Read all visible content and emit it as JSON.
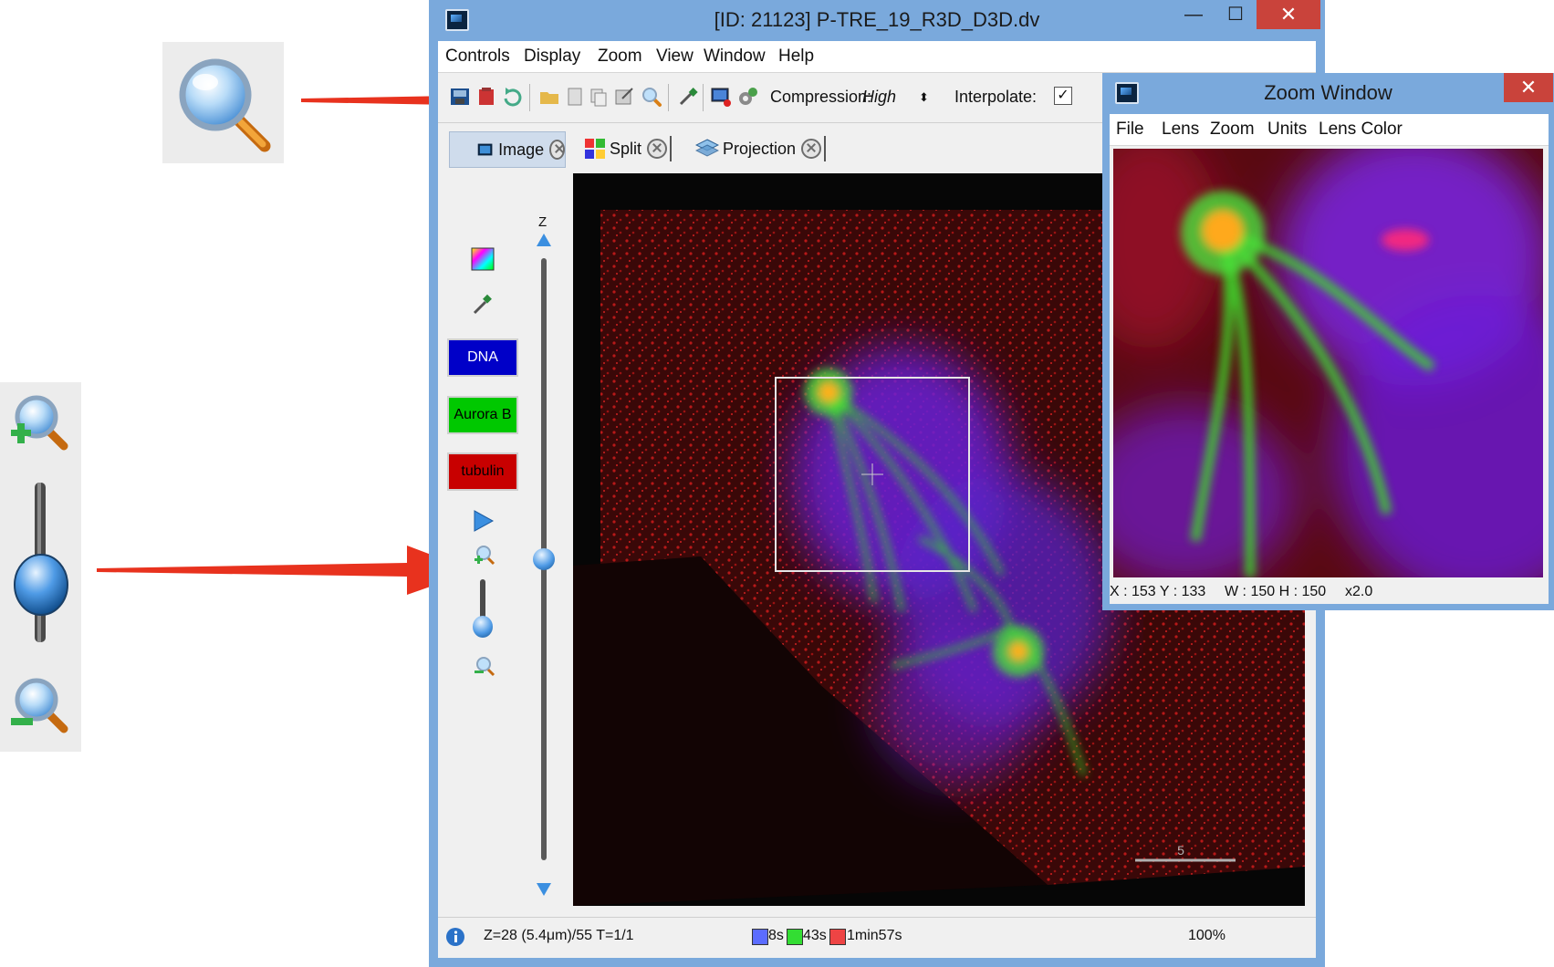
{
  "main_window": {
    "title": "[ID: 21123] P-TRE_19_R3D_D3D.dv",
    "controls": {
      "minimize": "—",
      "maximize": "☐",
      "close": "✕"
    },
    "menu": [
      "Controls",
      "Display",
      "Zoom",
      "View",
      "Window",
      "Help"
    ],
    "toolbar": {
      "icons": [
        "save-icon",
        "delete-icon",
        "refresh-icon",
        "open-folder-icon",
        "document-icon",
        "copy-icon",
        "image-edit-icon",
        "magnifier-icon",
        "pipette-icon",
        "screenshot-icon",
        "settings-icon"
      ],
      "compression_label": "Compression:",
      "compression_value": "High",
      "interpolate_label": "Interpolate:",
      "interpolate_checked": true
    },
    "tabs": [
      {
        "label": "Image",
        "icon": "image-tab-icon",
        "active": true
      },
      {
        "label": "Split",
        "icon": "split-grid-icon",
        "active": false
      },
      {
        "label": "Projection",
        "icon": "projection-layers-icon",
        "active": false
      }
    ],
    "tools": {
      "icons": [
        "color-picker-icon",
        "pipette-icon"
      ],
      "channels": [
        {
          "label": "DNA",
          "color": "#0000c8",
          "text_color": "#ffffff"
        },
        {
          "label": "Aurora B",
          "color": "#00c800",
          "text_color": "#000000"
        },
        {
          "label": "tubulin",
          "color": "#c80000",
          "text_color": "#000000"
        }
      ],
      "play_icon": "play-icon",
      "zoom_in_icon": "zoom-in-icon",
      "zoom_out_icon": "zoom-out-icon"
    },
    "z_slider": {
      "label": "Z",
      "level": 0.5
    },
    "scale_bar_label": "5",
    "status": {
      "info_icon": "info-icon",
      "position": "Z=28 (5.4μm)/55 T=1/1",
      "channels": [
        {
          "time": "8s",
          "color": "#5b6cff"
        },
        {
          "time": "43s",
          "color": "#33dd33"
        },
        {
          "time": "1min57s",
          "color": "#ee4444"
        }
      ],
      "zoom": "100%"
    }
  },
  "zoom_window": {
    "title": "Zoom Window",
    "close": "✕",
    "menu": [
      "File",
      "Lens",
      "Zoom",
      "Units",
      "Lens Color"
    ],
    "status": {
      "coords": "X : 153 Y : 133",
      "size": "W : 150 H : 150",
      "factor": "x2.0"
    }
  },
  "callouts": {
    "magnifier_icon": "magnifier-icon",
    "zoom_strip_icons": [
      "zoom-in-icon",
      "zoom-slider-icon",
      "zoom-out-icon"
    ]
  },
  "colors": {
    "window_frame": "#7aa9dc",
    "close_button": "#c9433b",
    "arrow": "#e8321e"
  }
}
